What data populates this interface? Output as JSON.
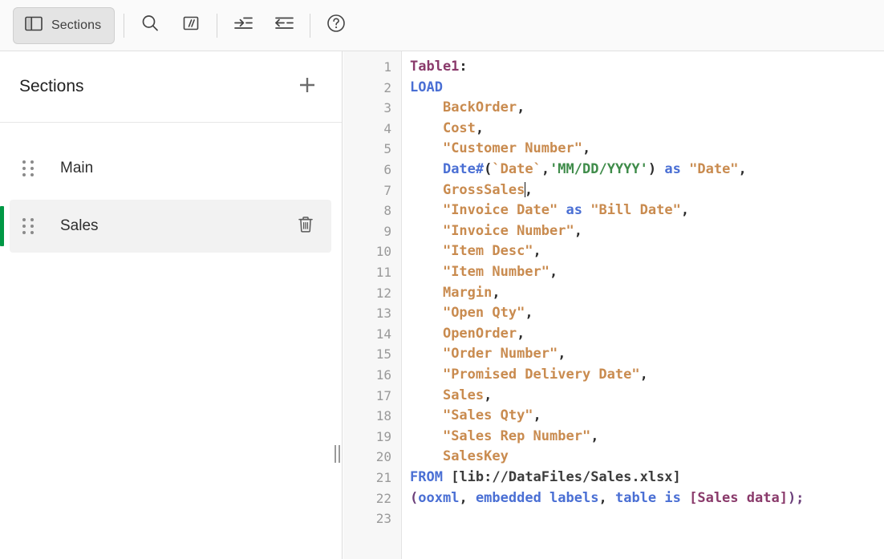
{
  "toolbar": {
    "sections_button_label": "Sections",
    "buttons": [
      {
        "name": "panel-icon",
        "title": "Sections"
      },
      {
        "name": "search-icon",
        "title": "Search"
      },
      {
        "name": "comment-icon",
        "title": "Comment"
      },
      {
        "name": "indent-right-icon",
        "title": "Indent"
      },
      {
        "name": "indent-left-icon",
        "title": "Outdent"
      },
      {
        "name": "help-icon",
        "title": "Help"
      }
    ]
  },
  "sidebar": {
    "title": "Sections",
    "add_label": "+",
    "items": [
      {
        "label": "Main",
        "selected": false,
        "deletable": false
      },
      {
        "label": "Sales",
        "selected": true,
        "deletable": true
      }
    ]
  },
  "colors": {
    "accent_green": "#009845",
    "keyword_blue": "#4a6fd4",
    "table_purple": "#8a3a6b",
    "field_tan": "#c98b4f",
    "string_green": "#3f8c4a",
    "bracket_purple": "#6b3f7a",
    "selected_bg": "#f2f2f2",
    "gutter_bg": "#f7f7f7"
  },
  "editor": {
    "line_count": 23,
    "cursor": {
      "line": 7,
      "column": 21
    },
    "lines": [
      {
        "n": 1,
        "tokens": [
          {
            "t": "tbl",
            "s": "Table1"
          },
          {
            "t": "pun",
            "s": ":"
          }
        ]
      },
      {
        "n": 2,
        "tokens": [
          {
            "t": "kw",
            "s": "LOAD"
          }
        ]
      },
      {
        "n": 3,
        "tokens": [
          {
            "t": "plain",
            "s": "    "
          },
          {
            "t": "fld",
            "s": "BackOrder"
          },
          {
            "t": "pun",
            "s": ","
          }
        ]
      },
      {
        "n": 4,
        "tokens": [
          {
            "t": "plain",
            "s": "    "
          },
          {
            "t": "fld",
            "s": "Cost"
          },
          {
            "t": "pun",
            "s": ","
          }
        ]
      },
      {
        "n": 5,
        "tokens": [
          {
            "t": "plain",
            "s": "    "
          },
          {
            "t": "fld",
            "s": "\"Customer Number\""
          },
          {
            "t": "pun",
            "s": ","
          }
        ]
      },
      {
        "n": 6,
        "tokens": [
          {
            "t": "plain",
            "s": "    "
          },
          {
            "t": "kw",
            "s": "Date#"
          },
          {
            "t": "pun",
            "s": "("
          },
          {
            "t": "fld",
            "s": "`Date`"
          },
          {
            "t": "pun",
            "s": ","
          },
          {
            "t": "str",
            "s": "'MM/DD/YYYY'"
          },
          {
            "t": "pun",
            "s": ")"
          },
          {
            "t": "plain",
            "s": " "
          },
          {
            "t": "kw",
            "s": "as"
          },
          {
            "t": "plain",
            "s": " "
          },
          {
            "t": "fld",
            "s": "\"Date\""
          },
          {
            "t": "pun",
            "s": ","
          }
        ]
      },
      {
        "n": 7,
        "tokens": [
          {
            "t": "plain",
            "s": "    "
          },
          {
            "t": "fld",
            "s": "GrossSales"
          },
          {
            "t": "caret",
            "s": ""
          },
          {
            "t": "pun",
            "s": ","
          }
        ]
      },
      {
        "n": 8,
        "tokens": [
          {
            "t": "plain",
            "s": "    "
          },
          {
            "t": "fld",
            "s": "\"Invoice Date\""
          },
          {
            "t": "plain",
            "s": " "
          },
          {
            "t": "kw",
            "s": "as"
          },
          {
            "t": "plain",
            "s": " "
          },
          {
            "t": "fld",
            "s": "\"Bill Date\""
          },
          {
            "t": "pun",
            "s": ","
          }
        ]
      },
      {
        "n": 9,
        "tokens": [
          {
            "t": "plain",
            "s": "    "
          },
          {
            "t": "fld",
            "s": "\"Invoice Number\""
          },
          {
            "t": "pun",
            "s": ","
          }
        ]
      },
      {
        "n": 10,
        "tokens": [
          {
            "t": "plain",
            "s": "    "
          },
          {
            "t": "fld",
            "s": "\"Item Desc\""
          },
          {
            "t": "pun",
            "s": ","
          }
        ]
      },
      {
        "n": 11,
        "tokens": [
          {
            "t": "plain",
            "s": "    "
          },
          {
            "t": "fld",
            "s": "\"Item Number\""
          },
          {
            "t": "pun",
            "s": ","
          }
        ]
      },
      {
        "n": 12,
        "tokens": [
          {
            "t": "plain",
            "s": "    "
          },
          {
            "t": "fld",
            "s": "Margin"
          },
          {
            "t": "pun",
            "s": ","
          }
        ]
      },
      {
        "n": 13,
        "tokens": [
          {
            "t": "plain",
            "s": "    "
          },
          {
            "t": "fld",
            "s": "\"Open Qty\""
          },
          {
            "t": "pun",
            "s": ","
          }
        ]
      },
      {
        "n": 14,
        "tokens": [
          {
            "t": "plain",
            "s": "    "
          },
          {
            "t": "fld",
            "s": "OpenOrder"
          },
          {
            "t": "pun",
            "s": ","
          }
        ]
      },
      {
        "n": 15,
        "tokens": [
          {
            "t": "plain",
            "s": "    "
          },
          {
            "t": "fld",
            "s": "\"Order Number\""
          },
          {
            "t": "pun",
            "s": ","
          }
        ]
      },
      {
        "n": 16,
        "tokens": [
          {
            "t": "plain",
            "s": "    "
          },
          {
            "t": "fld",
            "s": "\"Promised Delivery Date\""
          },
          {
            "t": "pun",
            "s": ","
          }
        ]
      },
      {
        "n": 17,
        "tokens": [
          {
            "t": "plain",
            "s": "    "
          },
          {
            "t": "fld",
            "s": "Sales"
          },
          {
            "t": "pun",
            "s": ","
          }
        ]
      },
      {
        "n": 18,
        "tokens": [
          {
            "t": "plain",
            "s": "    "
          },
          {
            "t": "fld",
            "s": "\"Sales Qty\""
          },
          {
            "t": "pun",
            "s": ","
          }
        ]
      },
      {
        "n": 19,
        "tokens": [
          {
            "t": "plain",
            "s": "    "
          },
          {
            "t": "fld",
            "s": "\"Sales Rep Number\""
          },
          {
            "t": "pun",
            "s": ","
          }
        ]
      },
      {
        "n": 20,
        "tokens": [
          {
            "t": "plain",
            "s": "    "
          },
          {
            "t": "fld",
            "s": "SalesKey"
          }
        ]
      },
      {
        "n": 21,
        "tokens": [
          {
            "t": "kw",
            "s": "FROM"
          },
          {
            "t": "plain",
            "s": " "
          },
          {
            "t": "plain",
            "s": "[lib://DataFiles/Sales.xlsx]"
          }
        ]
      },
      {
        "n": 22,
        "tokens": [
          {
            "t": "brk",
            "s": "("
          },
          {
            "t": "kw",
            "s": "ooxml"
          },
          {
            "t": "pun",
            "s": ","
          },
          {
            "t": "plain",
            "s": " "
          },
          {
            "t": "kw",
            "s": "embedded labels"
          },
          {
            "t": "pun",
            "s": ","
          },
          {
            "t": "plain",
            "s": " "
          },
          {
            "t": "kw",
            "s": "table is"
          },
          {
            "t": "plain",
            "s": " "
          },
          {
            "t": "tbl",
            "s": "[Sales data]"
          },
          {
            "t": "brk",
            "s": ");"
          }
        ]
      },
      {
        "n": 23,
        "tokens": []
      }
    ]
  }
}
